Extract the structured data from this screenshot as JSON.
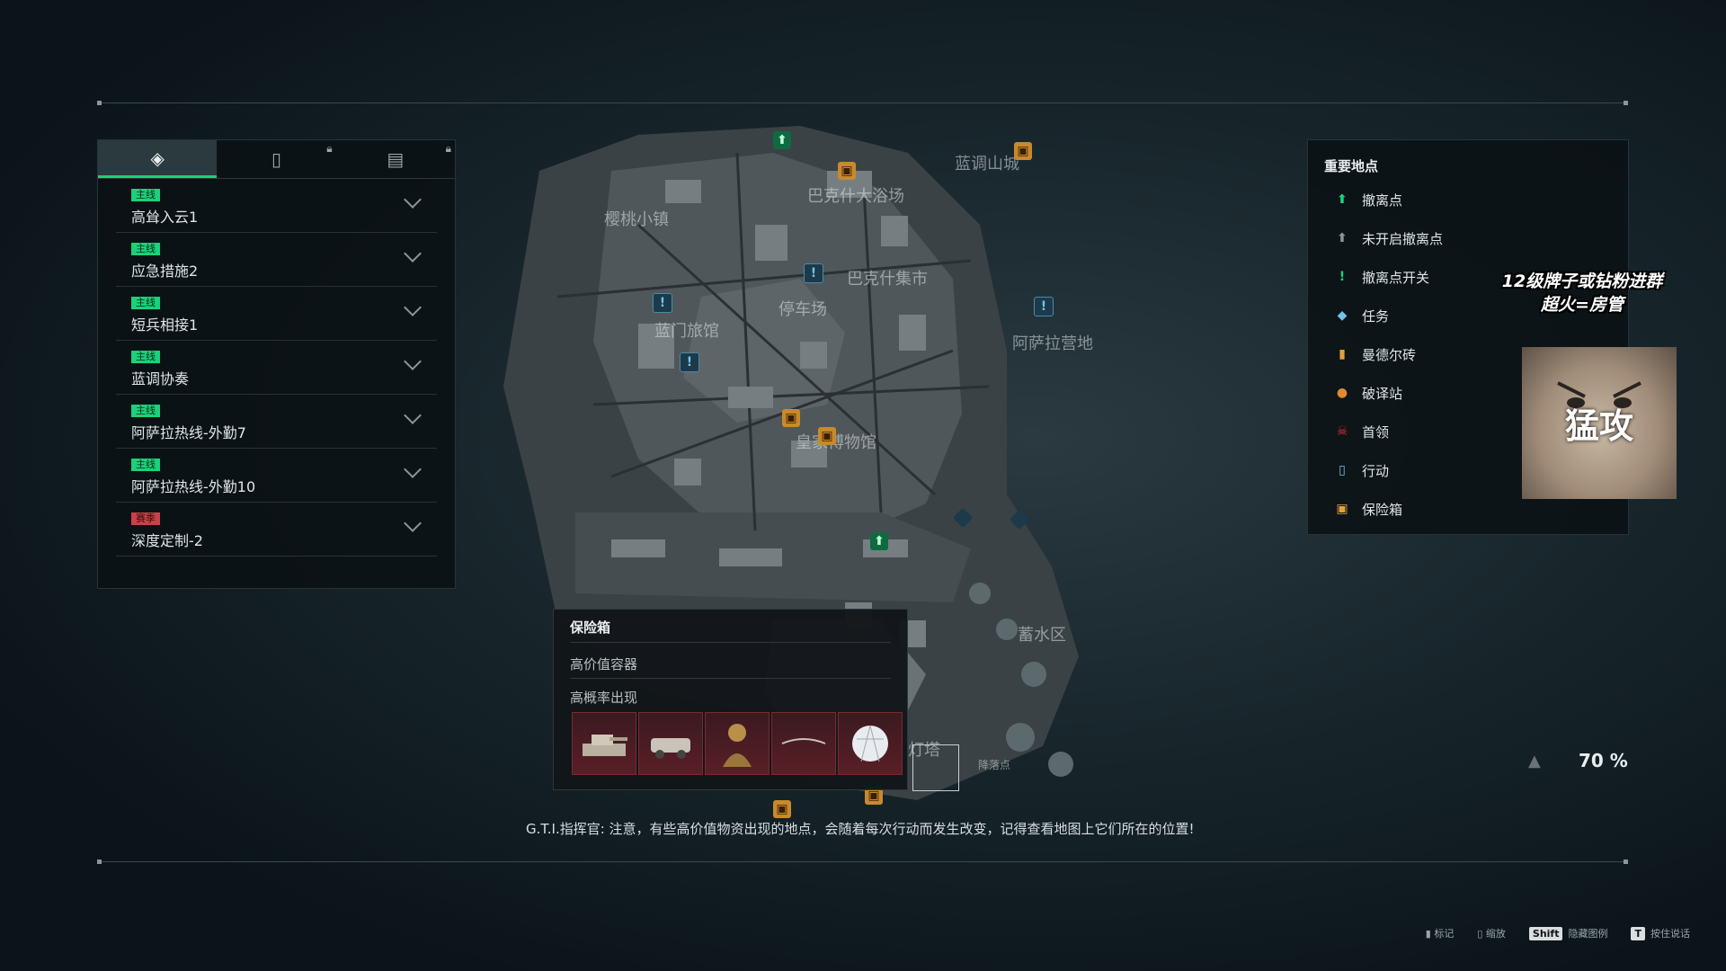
{
  "tabs": [
    {
      "icon": "task-icon"
    },
    {
      "icon": "action-icon",
      "locked": true
    },
    {
      "icon": "calendar-icon",
      "locked": true
    }
  ],
  "quests": [
    {
      "badge": "主线",
      "name": "高耸入云1",
      "type": "main"
    },
    {
      "badge": "主线",
      "name": "应急措施2",
      "type": "main"
    },
    {
      "badge": "主线",
      "name": "短兵相接1",
      "type": "main"
    },
    {
      "badge": "主线",
      "name": "蓝调协奏",
      "type": "main"
    },
    {
      "badge": "主线",
      "name": "阿萨拉热线-外勤7",
      "type": "main"
    },
    {
      "badge": "主线",
      "name": "阿萨拉热线-外勤10",
      "type": "main"
    },
    {
      "badge": "赛季",
      "name": "深度定制-2",
      "type": "season"
    }
  ],
  "map": {
    "labels": [
      "樱桃小镇",
      "巴克什大浴场",
      "蓝调山城",
      "巴克什集市",
      "停车场",
      "蓝门旅馆",
      "阿萨拉营地",
      "皇家博物馆",
      "蓄水区",
      "灯塔",
      "降落点"
    ]
  },
  "legend": {
    "title": "重要地点",
    "items": [
      {
        "label": "撤离点",
        "icon": "extraction-icon",
        "color": "#1bd17a"
      },
      {
        "label": "未开启撤离点",
        "icon": "closed-extraction-icon",
        "color": "#8a969a"
      },
      {
        "label": "撤离点开关",
        "icon": "extraction-switch-icon",
        "color": "#1bd17a"
      },
      {
        "label": "任务",
        "icon": "task-icon",
        "color": "#6fc4e8"
      },
      {
        "label": "曼德尔砖",
        "icon": "mandel-brick-icon",
        "color": "#e0a040"
      },
      {
        "label": "破译站",
        "icon": "decoder-icon",
        "color": "#e08a30"
      },
      {
        "label": "首领",
        "icon": "boss-icon",
        "color": "#d8303a"
      },
      {
        "label": "行动",
        "icon": "action-icon",
        "color": "#6fc4e8"
      },
      {
        "label": "保险箱",
        "icon": "safe-icon",
        "color": "#e0a040"
      }
    ]
  },
  "tooltip": {
    "title": "保险箱",
    "subtitle": "高价值容器",
    "subtitle2": "高概率出现",
    "items": [
      {
        "icon": "tank-model-icon"
      },
      {
        "icon": "armored-car-model-icon"
      },
      {
        "icon": "bust-statue-icon"
      },
      {
        "icon": "necklace-icon"
      },
      {
        "icon": "diamond-icon"
      }
    ]
  },
  "meme": {
    "line1": "12级牌子或钻粉进群",
    "line2": "超火=房管",
    "caption": "猛攻"
  },
  "zoom": "70 %",
  "subtitle": "G.T.I.指挥官:  注意，有些高价值物资出现的地点，会随着每次行动而发生改变，记得查看地图上它们所在的位置!",
  "hints": [
    {
      "label": "标记",
      "icon": "mouse-left-icon"
    },
    {
      "label": "缩放",
      "icon": "mouse-scroll-icon"
    },
    {
      "key": "Shift",
      "label": "隐藏图例"
    },
    {
      "key": "T",
      "label": "按住说话"
    }
  ]
}
